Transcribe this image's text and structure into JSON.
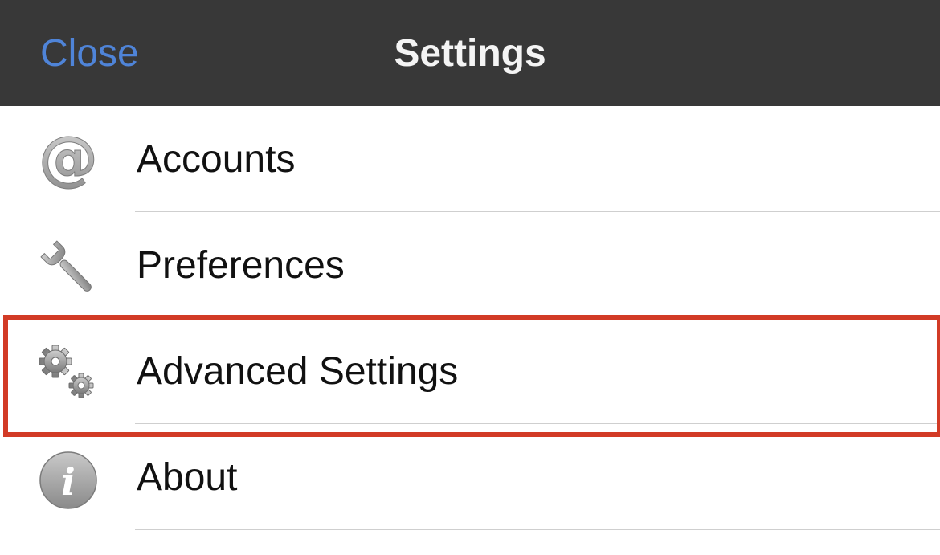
{
  "navbar": {
    "close_label": "Close",
    "title": "Settings",
    "close_color": "#4f84d8",
    "background": "#383838"
  },
  "settings_list": {
    "items": [
      {
        "label": "Accounts",
        "icon": "at-sign-icon"
      },
      {
        "label": "Preferences",
        "icon": "wrench-icon"
      },
      {
        "label": "Advanced Settings",
        "icon": "gears-icon",
        "highlighted": true
      },
      {
        "label": "About",
        "icon": "info-icon"
      }
    ]
  },
  "highlight_color": "#d23b26"
}
